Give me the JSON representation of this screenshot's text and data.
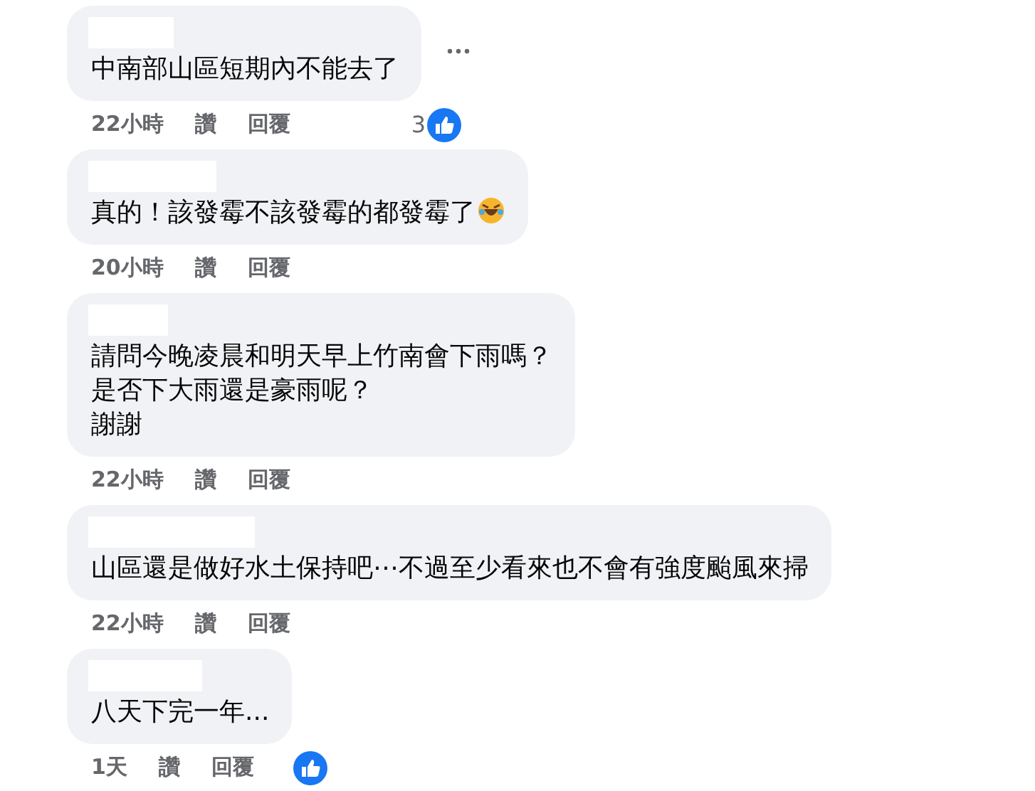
{
  "comments": [
    {
      "lines": [
        "中南部山區短期內不能去了"
      ],
      "trailing_emoji": false,
      "show_menu": true,
      "time": "22小時",
      "like_label": "讚",
      "reply_label": "回覆",
      "liked_badge": true,
      "like_count": "3"
    },
    {
      "lines": [
        "真的！該發霉不該發霉的都發霉了"
      ],
      "trailing_emoji": true,
      "show_menu": false,
      "time": "20小時",
      "like_label": "讚",
      "reply_label": "回覆",
      "liked_badge": false
    },
    {
      "lines": [
        "請問今晚凌晨和明天早上竹南會下雨嗎？",
        "是否下大雨還是豪雨呢？",
        "謝謝"
      ],
      "trailing_emoji": false,
      "show_menu": false,
      "time": "22小時",
      "like_label": "讚",
      "reply_label": "回覆",
      "liked_badge": false
    },
    {
      "lines": [
        "山區還是做好水土保持吧⋯不過至少看來也不會有強度颱風來掃"
      ],
      "trailing_emoji": false,
      "show_menu": false,
      "time": "22小時",
      "like_label": "讚",
      "reply_label": "回覆",
      "liked_badge": false
    },
    {
      "lines": [
        "八天下完一年..."
      ],
      "trailing_emoji": false,
      "show_menu": false,
      "time": "1天",
      "like_label": "讚",
      "reply_label": "回覆",
      "liked_badge": true
    }
  ]
}
